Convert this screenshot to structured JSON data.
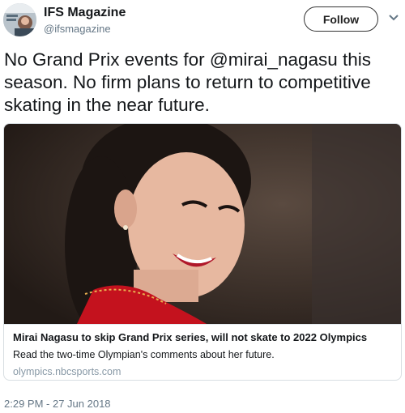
{
  "author": {
    "name": "IFS Magazine",
    "handle": "@ifsmagazine",
    "avatar_icon": "magazine-cover-avatar"
  },
  "follow_label": "Follow",
  "tweet": {
    "text": "No Grand Prix events for @mirai_nagasu this season. No firm plans to return to competitive skating in the near future.",
    "timestamp": "2:29 PM - 27 Jun 2018"
  },
  "card": {
    "title": "Mirai Nagasu to skip Grand Prix series, will not skate to 2022 Olympics",
    "description": "Read the two-time Olympian's comments about her future.",
    "domain": "olympics.nbcsports.com",
    "image_icon": "skater-photo"
  },
  "colors": {
    "text": "#14171a",
    "secondary": "#657786",
    "domain": "#8899a6",
    "border": "#d8dee2"
  }
}
